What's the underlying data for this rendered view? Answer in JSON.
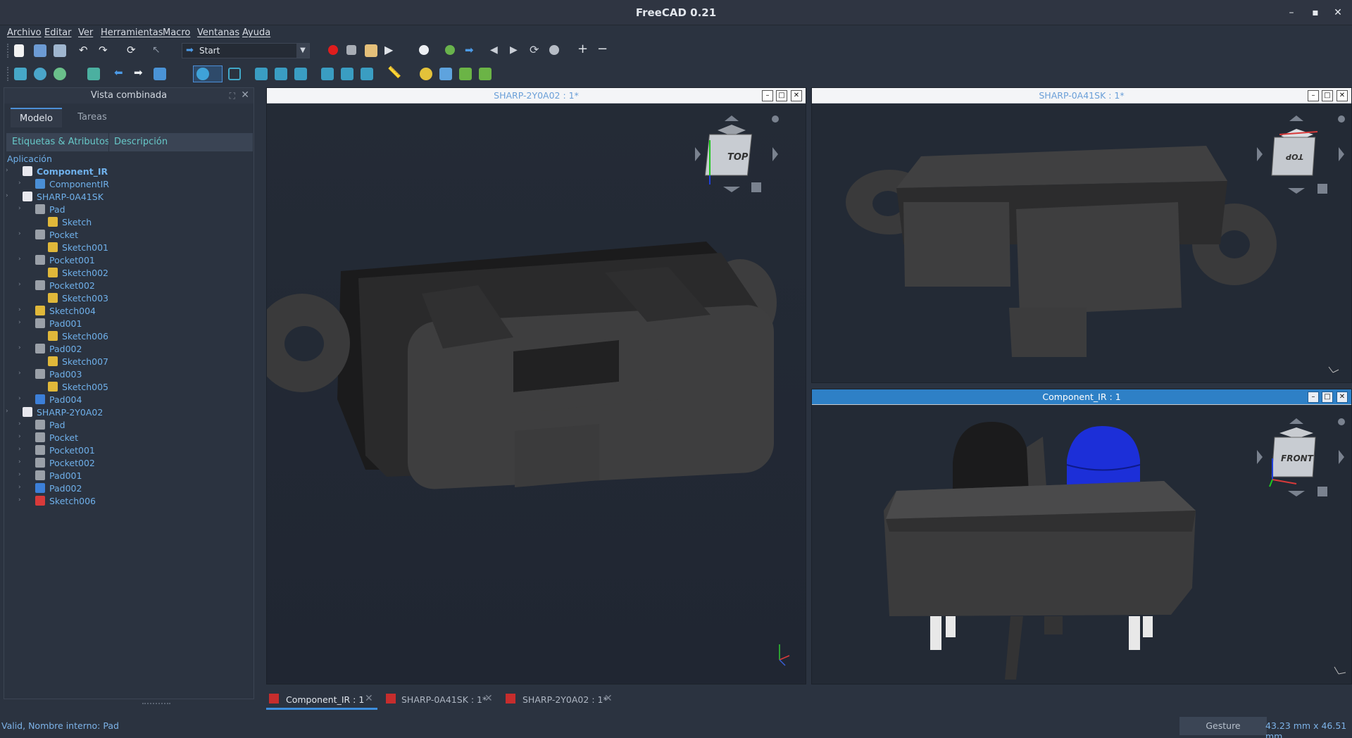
{
  "window": {
    "title": "FreeCAD 0.21",
    "minimize": "–",
    "maximize": "▪",
    "close": "✕"
  },
  "menu": [
    "Archivo",
    "Editar",
    "Ver",
    "Herramientas",
    "Macro",
    "Ventanas",
    "Ayuda"
  ],
  "workbench": {
    "selected": "Start"
  },
  "combo_view": {
    "title": "Vista combinada",
    "tabs": [
      "Modelo",
      "Tareas"
    ],
    "columns": [
      "Etiquetas & Atributos",
      "Descripción"
    ],
    "section": "Aplicación",
    "tree": [
      {
        "label": "Component_IR",
        "level": 0,
        "bold": true,
        "icon": "document-icon"
      },
      {
        "label": "ComponentIR",
        "level": 1,
        "icon": "part-icon"
      },
      {
        "label": "SHARP-0A41SK",
        "level": 0,
        "icon": "document-icon"
      },
      {
        "label": "Pad",
        "level": 1,
        "icon": "pad-icon"
      },
      {
        "label": "Sketch",
        "level": 2,
        "icon": "sketch-icon"
      },
      {
        "label": "Pocket",
        "level": 1,
        "icon": "pocket-icon"
      },
      {
        "label": "Sketch001",
        "level": 2,
        "icon": "sketch-icon"
      },
      {
        "label": "Pocket001",
        "level": 1,
        "icon": "pocket-icon"
      },
      {
        "label": "Sketch002",
        "level": 2,
        "icon": "sketch-icon"
      },
      {
        "label": "Pocket002",
        "level": 1,
        "icon": "pocket-icon"
      },
      {
        "label": "Sketch003",
        "level": 2,
        "icon": "sketch-icon"
      },
      {
        "label": "Sketch004",
        "level": 1,
        "icon": "sketch-icon"
      },
      {
        "label": "Pad001",
        "level": 1,
        "icon": "pad-icon"
      },
      {
        "label": "Sketch006",
        "level": 2,
        "icon": "sketch-icon"
      },
      {
        "label": "Pad002",
        "level": 1,
        "icon": "pad-icon"
      },
      {
        "label": "Sketch007",
        "level": 2,
        "icon": "sketch-icon"
      },
      {
        "label": "Pad003",
        "level": 1,
        "icon": "pad-icon"
      },
      {
        "label": "Sketch005",
        "level": 2,
        "icon": "sketch-icon"
      },
      {
        "label": "Pad004",
        "level": 1,
        "icon": "pad-blue-icon"
      },
      {
        "label": "SHARP-2Y0A02",
        "level": 0,
        "icon": "document-icon"
      },
      {
        "label": "Pad",
        "level": 1,
        "icon": "pad-icon"
      },
      {
        "label": "Pocket",
        "level": 1,
        "icon": "pocket-icon"
      },
      {
        "label": "Pocket001",
        "level": 1,
        "icon": "pocket-icon"
      },
      {
        "label": "Pocket002",
        "level": 1,
        "icon": "pocket-icon"
      },
      {
        "label": "Pad001",
        "level": 1,
        "icon": "pad-icon"
      },
      {
        "label": "Pad002",
        "level": 1,
        "icon": "pad-blue-icon"
      },
      {
        "label": "Sketch006",
        "level": 1,
        "icon": "sketch-red-icon"
      }
    ]
  },
  "views": [
    {
      "title": "SHARP-2Y0A02 : 1*",
      "navcube": "TOP"
    },
    {
      "title": "SHARP-0A41SK : 1*",
      "navcube": "TOP"
    },
    {
      "title": "Component_IR : 1",
      "navcube": "FRONT",
      "active": true
    }
  ],
  "doc_tabs": [
    {
      "label": "Component_IR : 1",
      "active": true
    },
    {
      "label": "SHARP-0A41SK : 1*"
    },
    {
      "label": "SHARP-2Y0A02 : 1*"
    }
  ],
  "status": {
    "message": "Valid, Nombre interno: Pad",
    "nav_style": "Gesture",
    "dimensions": "43.23 mm x 46.51 mm"
  },
  "colors": {
    "accent": "#2e80c6",
    "tree_text": "#6fb0ea",
    "viewport_bg": "#232a35",
    "sensor_blue": "#1c2fd8"
  }
}
